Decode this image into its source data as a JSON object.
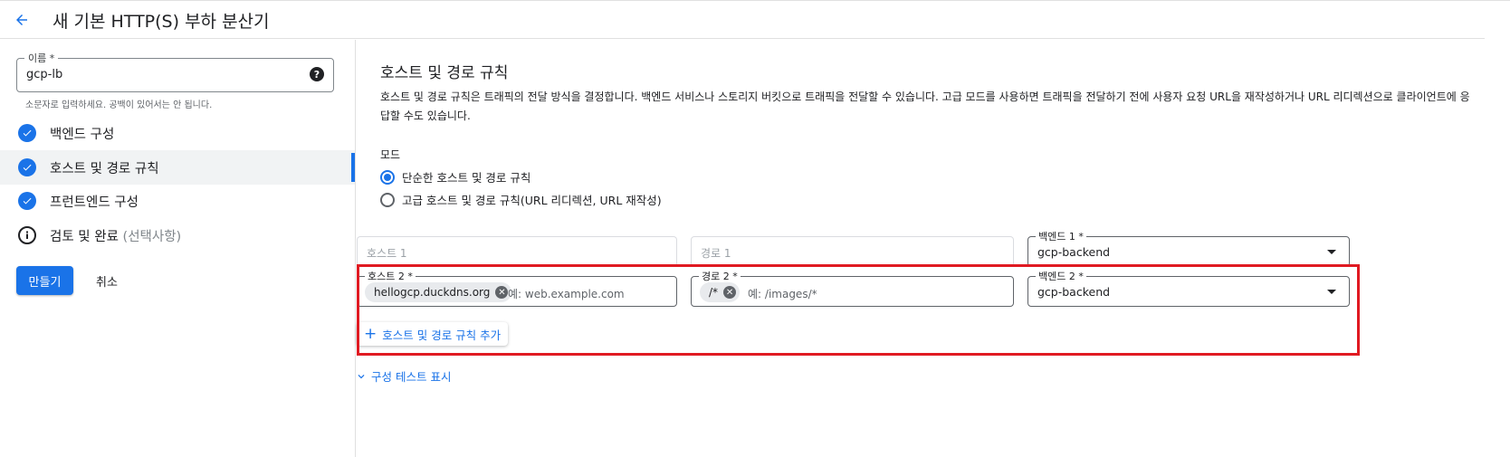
{
  "header": {
    "title": "새 기본 HTTP(S) 부하 분산기"
  },
  "sidebar": {
    "name_label": "이름 *",
    "name_value": "gcp-lb",
    "name_hint": "소문자로 입력하세요. 공백이 있어서는 안 됩니다.",
    "steps": [
      {
        "label": "백엔드 구성",
        "status": "done"
      },
      {
        "label": "호스트 및 경로 규칙",
        "status": "done"
      },
      {
        "label": "프런트엔드 구성",
        "status": "done"
      },
      {
        "label": "검토 및 완료",
        "optional": "(선택사항)",
        "status": "info"
      }
    ],
    "create_label": "만들기",
    "cancel_label": "취소"
  },
  "main": {
    "section_title": "호스트 및 경로 규칙",
    "description": "호스트 및 경로 규칙은 트래픽의 전달 방식을 결정합니다. 백엔드 서비스나 스토리지 버킷으로 트래픽을 전달할 수 있습니다. 고급 모드를 사용하면 트래픽을 전달하기 전에 사용자 요청 URL을 재작성하거나 URL 리디렉션으로 클라이언트에 응답할 수도 있습니다.",
    "mode_label": "모드",
    "mode_options": [
      "단순한 호스트 및 경로 규칙",
      "고급 호스트 및 경로 규칙(URL 리디렉션, URL 재작성)"
    ],
    "row1": {
      "host_placeholder": "호스트 1",
      "path_placeholder": "경로 1",
      "backend_label": "백엔드 1 *",
      "backend_value": "gcp-backend"
    },
    "row2": {
      "host_label": "호스트 2 *",
      "host_chip": "hellogcp.duckdns.org",
      "host_placeholder": "예: web.example.com",
      "path_label": "경로 2 *",
      "path_chip": "/*",
      "path_placeholder": "예: /images/*",
      "backend_label": "백엔드 2 *",
      "backend_value": "gcp-backend"
    },
    "add_rule_label": "호스트 및 경로 규칙 추가",
    "show_config_label": "구성 테스트 표시"
  },
  "colors": {
    "accent": "#1a73e8",
    "highlight": "#e01a22"
  }
}
